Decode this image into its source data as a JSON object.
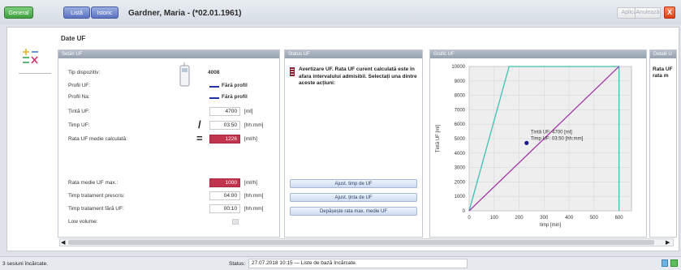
{
  "tabs": [
    {
      "label": "General"
    },
    {
      "label": "Listă"
    },
    {
      "label": "Istoric"
    }
  ],
  "patient_name": "Gardner, Maria - (*02.01.1961)",
  "toolbar": {
    "aplica": "Aplică",
    "anuleaza": "Anulează",
    "close": "X"
  },
  "page_title": "Date UF",
  "panels": {
    "setari": "Setări UF",
    "status": "Status UF",
    "grafic": "Grafic UF",
    "detalii": "Detalii U"
  },
  "setari": {
    "tip_dispozitiv_label": "Tip dispozitiv:",
    "tip_dispozitiv_value": "4008",
    "profil_uf_label": "Profil UF:",
    "profil_uf_value": "Fără profil",
    "profil_na_label": "Profil Na:",
    "profil_na_value": "Fără profil",
    "tinta_label": "Țintă UF:",
    "tinta_value": "4700",
    "tinta_unit": "[ml]",
    "timp_label": "Timp UF:",
    "timp_value": "03:50",
    "timp_unit": "[hh:mm]",
    "rata_label": "Rata UF medie calculată:",
    "rata_value": "1226",
    "rata_unit": "[ml/h]",
    "rata_max_label": "Rata medie UF max.:",
    "rata_max_value": "1000",
    "rata_max_unit": "[ml/h]",
    "timp_prescris_label": "Timp tratament prescris:",
    "timp_prescris_value": "04:00",
    "timp_prescris_unit": "[hh:mm]",
    "timp_fara_label": "Timp tratament fără UF:",
    "timp_fara_value": "00:10",
    "timp_fara_unit": "[hh:mm]",
    "low_volume_label": "Low volume:"
  },
  "status": {
    "warning": "Avertizare UF. Rata UF curent calculată este în afara intervalului admisibil. Selectați una dintre aceste acțiuni:",
    "btn1": "Ajust. timp de UF",
    "btn2": "Ajust. ținta de UF",
    "btn3": "Depășește rata max. medie UF"
  },
  "detalii": {
    "text": "Rata UF rata m"
  },
  "chart_data": {
    "type": "line",
    "xlabel": "timp [min]",
    "ylabel": "Țintă UF [ml]",
    "xlim": [
      0,
      650
    ],
    "ylim": [
      0,
      10000
    ],
    "xticks": [
      0,
      100,
      200,
      300,
      400,
      500,
      600
    ],
    "yticks": [
      0,
      1000,
      2000,
      3000,
      4000,
      5000,
      6000,
      7000,
      8000,
      9000,
      10000
    ],
    "series": [
      {
        "name": "",
        "color": "#3fc0b0",
        "x": [
          0,
          160,
          600,
          600
        ],
        "y": [
          0,
          10000,
          10000,
          0
        ]
      },
      {
        "name": "",
        "color": "#a23aa8",
        "x": [
          0,
          600
        ],
        "y": [
          0,
          10000
        ]
      }
    ],
    "point": {
      "x": 230,
      "y": 4700,
      "color": "#1a1a8c"
    },
    "annotation": [
      "Țintă UF: 4700 [ml]",
      "Timp UF: 03:50 [hh:mm]"
    ],
    "grid": true
  },
  "statusbar": {
    "left": "3 sesiuni încărcate.",
    "label": "Status:",
    "value": "27.07.2018 10:15 — Liste de bază încărcate."
  }
}
